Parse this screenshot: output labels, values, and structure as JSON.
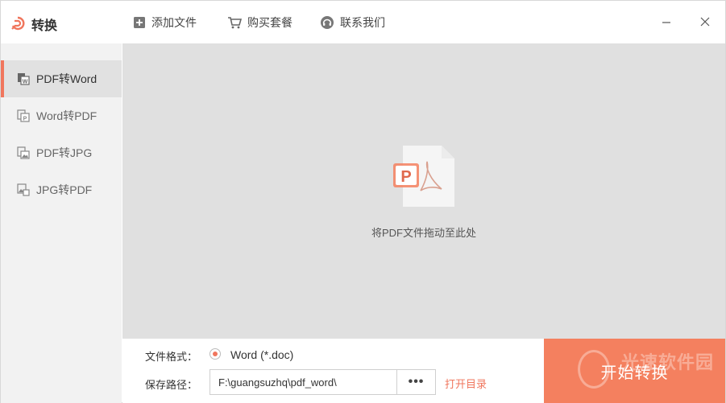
{
  "app": {
    "title": "转换",
    "brand_color": "#f0765d"
  },
  "toolbar": {
    "add_file": "添加文件",
    "buy_package": "购买套餐",
    "contact_us": "联系我们"
  },
  "window_controls": {
    "minimize": "minimize-icon",
    "close": "close-icon"
  },
  "sidebar": {
    "items": [
      {
        "label": "PDF转Word",
        "active": true
      },
      {
        "label": "Word转PDF",
        "active": false
      },
      {
        "label": "PDF转JPG",
        "active": false
      },
      {
        "label": "JPG转PDF",
        "active": false
      }
    ]
  },
  "drop_area": {
    "hint": "将PDF文件拖动至此处"
  },
  "bottom": {
    "format_label": "文件格式：",
    "format_option": "Word (*.doc)",
    "path_label": "保存路径：",
    "path_value": "F:\\guangsuzhq\\pdf_word\\",
    "browse_label": "•••",
    "open_dir": "打开目录",
    "start_label": "开始转换",
    "watermark": "光速软件园"
  }
}
